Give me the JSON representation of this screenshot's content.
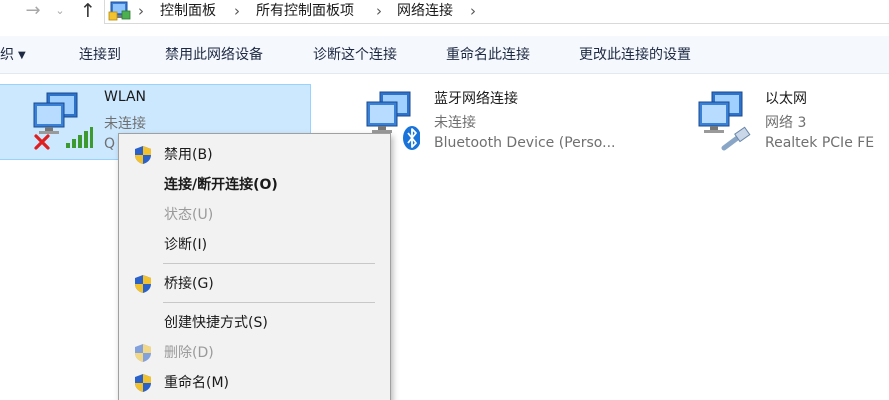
{
  "address_bar": {
    "crumbs": [
      "控制面板",
      "所有控制面板项",
      "网络连接"
    ],
    "icons": [
      "back-arrow-icon",
      "forward-arrow-icon",
      "history-chevron-icon",
      "up-arrow-icon",
      "control-panel-icon",
      "breadcrumb-chevron-icon"
    ]
  },
  "command_bar": {
    "organize_label": "组织",
    "connect_to_label": "连接到",
    "disable_device_label": "禁用此网络设备",
    "diagnose_label": "诊断这个连接",
    "rename_label": "重命名此连接",
    "change_settings_label": "更改此连接的设置"
  },
  "connections": [
    {
      "name": "WLAN",
      "status": "未连接",
      "device": "Q",
      "selected": true,
      "icons": [
        "wireless-network-icon",
        "red-x-icon",
        "signal-bars-icon"
      ]
    },
    {
      "name": "蓝牙网络连接",
      "status": "未连接",
      "device": "Bluetooth Device (Perso...",
      "selected": false,
      "icons": [
        "bluetooth-network-icon"
      ]
    },
    {
      "name": "以太网",
      "status": "网络  3",
      "device": "Realtek PCIe FE",
      "selected": false,
      "icons": [
        "ethernet-network-icon"
      ]
    }
  ],
  "context_menu": {
    "items": [
      {
        "label": "禁用(B)",
        "shield": true,
        "state": "normal"
      },
      {
        "label": "连接/断开连接(O)",
        "shield": false,
        "state": "default"
      },
      {
        "label": "状态(U)",
        "shield": false,
        "state": "disabled"
      },
      {
        "label": "诊断(I)",
        "shield": false,
        "state": "normal"
      },
      {
        "label": "桥接(G)",
        "shield": true,
        "state": "normal"
      },
      {
        "label": "创建快捷方式(S)",
        "shield": false,
        "state": "normal"
      },
      {
        "label": "删除(D)",
        "shield": true,
        "state": "disabled"
      },
      {
        "label": "重命名(M)",
        "shield": true,
        "state": "normal"
      }
    ]
  },
  "colors": {
    "selection_fill": "#cce8ff",
    "selection_border": "#99d1ff",
    "command_bar_bg": "#f5f8fc",
    "menu_bg": "#f2f2f2",
    "disabled_text": "#9a9a9a",
    "secondary_text": "#707070"
  }
}
